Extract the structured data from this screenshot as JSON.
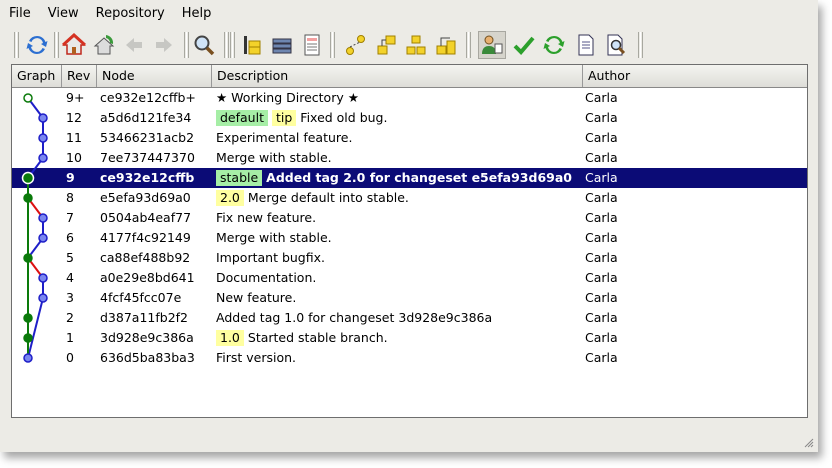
{
  "menu": [
    {
      "label": "File"
    },
    {
      "label": "View"
    },
    {
      "label": "Repository"
    },
    {
      "label": "Help"
    }
  ],
  "toolbar": {
    "icons": [
      "refresh-icon",
      "home-icon",
      "pull-icon",
      "back-arrow-icon",
      "forward-arrow-icon",
      "search-icon",
      "revision-icon",
      "stack-icon",
      "log-icon",
      "tag-add-icon",
      "tag-branch-icon",
      "tag-compare-icon",
      "tag-merge-icon",
      "user-icon",
      "check-icon",
      "sync-icon",
      "document-icon",
      "zoom-document-icon"
    ]
  },
  "columns": {
    "graph": "Graph",
    "rev": "Rev",
    "node": "Node",
    "description": "Description",
    "author": "Author"
  },
  "rows": [
    {
      "rev": "9+",
      "node": "ce932e12cffb+",
      "tags": [],
      "desc": "★ Working Directory ★",
      "author": "Carla",
      "selected": false
    },
    {
      "rev": "12",
      "node": "a5d6d121fe34",
      "tags": [
        {
          "text": "default",
          "kind": "branch"
        },
        {
          "text": "tip",
          "kind": "tip"
        }
      ],
      "desc": "Fixed old bug.",
      "author": "Carla",
      "selected": false
    },
    {
      "rev": "11",
      "node": "53466231acb2",
      "tags": [],
      "desc": "Experimental feature.",
      "author": "Carla",
      "selected": false
    },
    {
      "rev": "10",
      "node": "7ee737447370",
      "tags": [],
      "desc": "Merge with stable.",
      "author": "Carla",
      "selected": false
    },
    {
      "rev": "9",
      "node": "ce932e12cffb",
      "tags": [
        {
          "text": "stable",
          "kind": "branch"
        }
      ],
      "desc": "Added tag 2.0 for changeset e5efa93d69a0",
      "author": "Carla",
      "selected": true
    },
    {
      "rev": "8",
      "node": "e5efa93d69a0",
      "tags": [
        {
          "text": "2.0",
          "kind": "tip"
        }
      ],
      "desc": "Merge default into stable.",
      "author": "Carla",
      "selected": false
    },
    {
      "rev": "7",
      "node": "0504ab4eaf77",
      "tags": [],
      "desc": "Fix new feature.",
      "author": "Carla",
      "selected": false
    },
    {
      "rev": "6",
      "node": "4177f4c92149",
      "tags": [],
      "desc": "Merge with stable.",
      "author": "Carla",
      "selected": false
    },
    {
      "rev": "5",
      "node": "ca88ef488b92",
      "tags": [],
      "desc": "Important bugfix.",
      "author": "Carla",
      "selected": false
    },
    {
      "rev": "4",
      "node": "a0e29e8bd641",
      "tags": [],
      "desc": "Documentation.",
      "author": "Carla",
      "selected": false
    },
    {
      "rev": "3",
      "node": "4fcf45fcc07e",
      "tags": [],
      "desc": "New feature.",
      "author": "Carla",
      "selected": false
    },
    {
      "rev": "2",
      "node": "d387a11fb2f2",
      "tags": [],
      "desc": "Added tag 1.0 for changeset 3d928e9c386a",
      "author": "Carla",
      "selected": false
    },
    {
      "rev": "1",
      "node": "3d928e9c386a",
      "tags": [
        {
          "text": "1.0",
          "kind": "tip"
        }
      ],
      "desc": "Started stable branch.",
      "author": "Carla",
      "selected": false
    },
    {
      "rev": "0",
      "node": "636d5ba83ba3",
      "tags": [],
      "desc": "First version.",
      "author": "Carla",
      "selected": false
    }
  ],
  "colors": {
    "selection": "#0b0b76",
    "branch_tag": "#a6eea6",
    "tip_tag": "#ffffa0",
    "default_branch": "#1e1ec8",
    "stable_branch": "#0a7a0a",
    "merge_edge": "#dd1111"
  }
}
